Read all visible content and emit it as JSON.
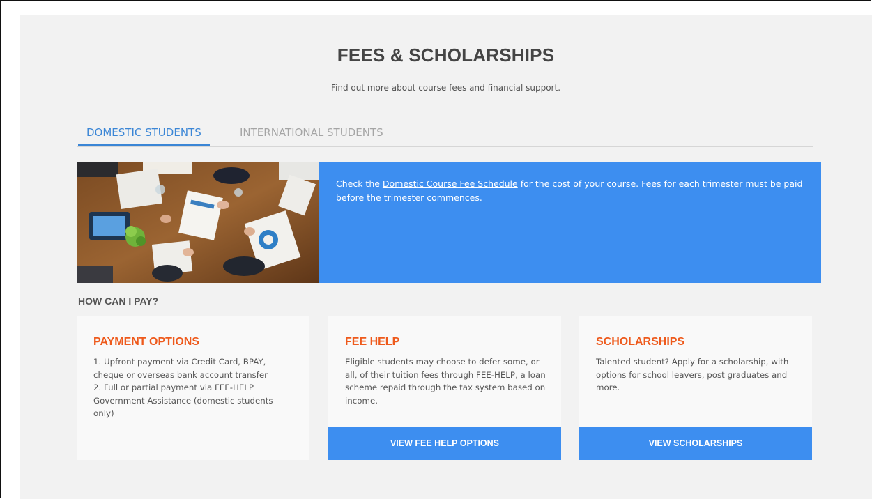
{
  "header": {
    "title": "FEES & SCHOLARSHIPS",
    "subtitle": "Find out more about course fees and financial support."
  },
  "tabs": [
    {
      "label": "DOMESTIC STUDENTS",
      "active": true
    },
    {
      "label": "INTERNATIONAL STUDENTS",
      "active": false
    }
  ],
  "hero": {
    "text_before": "Check the ",
    "link_text": "Domestic Course Fee Schedule",
    "text_after": " for the cost of your course. Fees for each trimester must be paid before the trimester commences."
  },
  "how_to_pay": {
    "heading": "HOW CAN I PAY?"
  },
  "cards": [
    {
      "title": "PAYMENT OPTIONS",
      "body": "1. Upfront payment via Credit Card, BPAY, cheque or overseas bank account transfer\n2. Full or partial payment via FEE-HELP Government Assistance (domestic students only)",
      "button": null
    },
    {
      "title": "FEE HELP",
      "body": "Eligible students may choose to defer some, or all, of their tuition fees through FEE-HELP, a loan scheme repaid through the tax system based on income.",
      "button": "VIEW FEE HELP OPTIONS"
    },
    {
      "title": "SCHOLARSHIPS",
      "body": "Talented student? Apply for a scholarship, with options for school leavers, post graduates and more.",
      "button": "VIEW SCHOLARSHIPS"
    }
  ],
  "colors": {
    "accent_blue": "#3d8ef0",
    "tab_active": "#3b86d6",
    "card_title_orange": "#ee5a1c",
    "panel_bg": "#f2f2f2"
  }
}
